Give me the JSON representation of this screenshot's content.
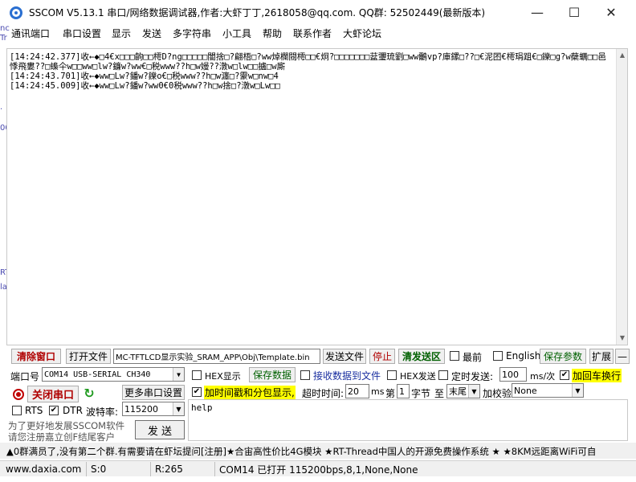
{
  "window": {
    "title": "SSCOM V5.13.1 串口/网络数据调试器,作者:大虾丁丁,2618058@qq.com. QQ群: 52502449(最新版本)",
    "minimize": "—",
    "maximize": "☐",
    "close": "✕"
  },
  "menu": [
    "通讯端口",
    "串口设置",
    "显示",
    "发送",
    "多字符串",
    "小工具",
    "帮助",
    "联系作者",
    "大虾论坛"
  ],
  "receive": {
    "text": "[14:24:42.377]收←◆□4€x□□□齣□□樗D?ng□□□□□闇捨□?翩梧□?ww焯欄閸樗□□€炯?□□□□□□□葐瓕琉劉□ww鸍vp?庫鏍□??□€泥囨€樗琄跙€□鑠□g?w蘗蠣□□邑悸飛婁??□蟂仐w□□ww□lw?鐮w?ww€□税www??h□w嫚??潡w□lw□□攎□w廝\n[14:24:43.701]收←◆ww□Lw?鐇w?鑠o€□税www??h□w瀍□?霥w□nw□4\n[14:24:45.009]收←◆ww□Lw?鐇w?ww0€0税www??h□w捨□?潡w□Lw□□"
  },
  "edge_artifacts": [
    "nc",
    "Tr",
    ".",
    "00",
    "RT",
    "la"
  ],
  "controls": {
    "clear_window": "清除窗口",
    "open_file": "打开文件",
    "file_path": "MC-TFTLCD显示实验_SRAM_APP\\Obj\\Template.bin",
    "send_file": "发送文件",
    "stop": "停止",
    "clear_send": "清发送区",
    "last": "最前",
    "english": "English",
    "save_params": "保存参数",
    "expand": "扩展",
    "collapse": "—",
    "port_label": "端口号",
    "port_value": "COM14 USB-SERIAL CH340",
    "hex_display": "HEX显示",
    "save_data": "保存数据",
    "recv_to_file": "接收数据到文件",
    "hex_send": "HEX发送",
    "timed_send": "定时发送:",
    "interval": "100",
    "interval_unit": "ms/次",
    "add_crlf": "加回车换行",
    "close_port": "关闭串口",
    "more_settings": "更多串口设置",
    "add_timestamp": "加时间戳和分包显示,",
    "timeout_label": "超时时间:",
    "timeout_value": "20",
    "ms": "ms",
    "nth_label": "第",
    "nth_value": "1",
    "byte_label": "字节",
    "to_label": "至",
    "end_value": "末尾",
    "checksum_label": "加校验",
    "checksum_value": "None",
    "rts": "RTS",
    "dtr": "DTR",
    "baud_label": "波特率:",
    "baud_value": "115200",
    "promo_line1": "为了更好地发展SSCOM软件",
    "promo_line2": "请您注册嘉立创F结尾客户",
    "send_button": "发 送",
    "send_text": "help"
  },
  "marquee": "▲0群满员了,没有第二个群.有需要请在虾坛提问[注册]★合宙高性价比4G模块 ★RT-Thread中国人的开源免费操作系统 ★ ★8KM远距离WiFi可自",
  "status": {
    "website": "www.daxia.com",
    "sent": "S:0",
    "received": "R:265",
    "port_status": "COM14 已打开  115200bps,8,1,None,None"
  }
}
